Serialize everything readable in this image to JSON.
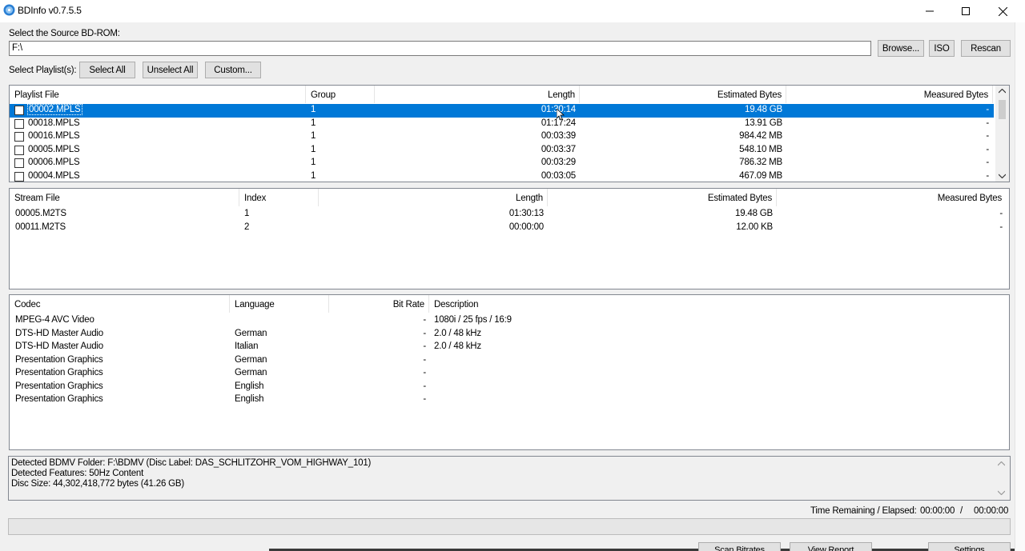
{
  "window": {
    "title": "BDInfo v0.7.5.5"
  },
  "source": {
    "label": "Select the Source BD-ROM:",
    "value": "F:\\",
    "browse": "Browse...",
    "iso": "ISO",
    "rescan": "Rescan"
  },
  "playlist_select": {
    "label": "Select Playlist(s):",
    "select_all": "Select All",
    "unselect_all": "Unselect All",
    "custom": "Custom..."
  },
  "playlists": {
    "headers": [
      "Playlist File",
      "Group",
      "Length",
      "Estimated Bytes",
      "Measured Bytes"
    ],
    "rows": [
      {
        "file": "00002.MPLS",
        "group": "1",
        "length": "01:30:14",
        "est": "19.48 GB",
        "measured": "-"
      },
      {
        "file": "00018.MPLS",
        "group": "1",
        "length": "01:17:24",
        "est": "13.91 GB",
        "measured": "-"
      },
      {
        "file": "00016.MPLS",
        "group": "1",
        "length": "00:03:39",
        "est": "984.42 MB",
        "measured": "-"
      },
      {
        "file": "00005.MPLS",
        "group": "1",
        "length": "00:03:37",
        "est": "548.10 MB",
        "measured": "-"
      },
      {
        "file": "00006.MPLS",
        "group": "1",
        "length": "00:03:29",
        "est": "786.32 MB",
        "measured": "-"
      },
      {
        "file": "00004.MPLS",
        "group": "1",
        "length": "00:03:05",
        "est": "467.09 MB",
        "measured": "-"
      }
    ]
  },
  "streams": {
    "headers": [
      "Stream File",
      "Index",
      "Length",
      "Estimated Bytes",
      "Measured Bytes"
    ],
    "rows": [
      {
        "file": "00005.M2TS",
        "index": "1",
        "length": "01:30:13",
        "est": "19.48 GB",
        "measured": "-"
      },
      {
        "file": "00011.M2TS",
        "index": "2",
        "length": "00:00:00",
        "est": "12.00 KB",
        "measured": "-"
      }
    ]
  },
  "codecs": {
    "headers": [
      "Codec",
      "Language",
      "Bit Rate",
      "Description"
    ],
    "rows": [
      {
        "codec": "MPEG-4 AVC Video",
        "language": "",
        "bitrate": "-",
        "desc": "1080i / 25 fps / 16:9"
      },
      {
        "codec": "DTS-HD Master Audio",
        "language": "German",
        "bitrate": "-",
        "desc": "2.0 / 48 kHz"
      },
      {
        "codec": "DTS-HD Master Audio",
        "language": "Italian",
        "bitrate": "-",
        "desc": "2.0 / 48 kHz"
      },
      {
        "codec": "Presentation Graphics",
        "language": "German",
        "bitrate": "-",
        "desc": ""
      },
      {
        "codec": "Presentation Graphics",
        "language": "German",
        "bitrate": "-",
        "desc": ""
      },
      {
        "codec": "Presentation Graphics",
        "language": "English",
        "bitrate": "-",
        "desc": ""
      },
      {
        "codec": "Presentation Graphics",
        "language": "English",
        "bitrate": "-",
        "desc": ""
      }
    ]
  },
  "status": {
    "line1": "Detected BDMV Folder: F:\\BDMV (Disc Label: DAS_SCHLITZOHR_VOM_HIGHWAY_101)",
    "line2": "Detected Features: 50Hz Content",
    "line3": "Disc Size: 44,302,418,772 bytes (41.26 GB)"
  },
  "timing": {
    "label": "Time Remaining / Elapsed:",
    "remaining": "00:00:00",
    "sep": "/",
    "elapsed": "00:00:00"
  },
  "progress_fraction": 0,
  "bottom_buttons": {
    "scan": "Scan Bitrates",
    "report": "View Report",
    "settings": "Settings"
  }
}
